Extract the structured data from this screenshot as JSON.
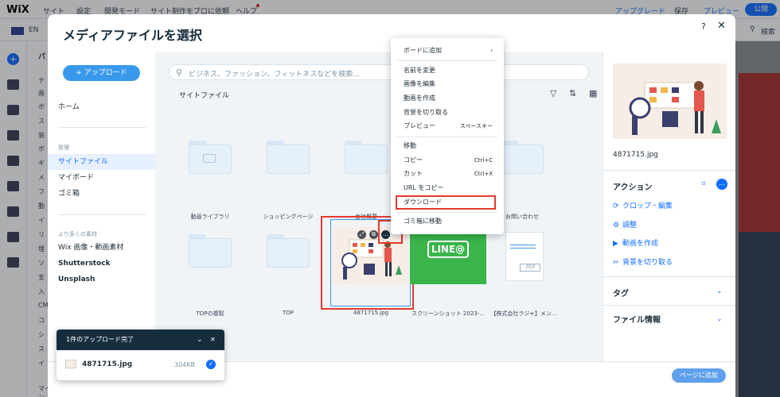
{
  "editor": {
    "logo": "WiX",
    "menu": [
      "サイト",
      "設定",
      "開発モード",
      "サイト制作をプロに依頼",
      "ヘルプ"
    ],
    "right_menu": [
      "アップグレード",
      "保存",
      "プレビュー"
    ],
    "publish": "公開",
    "language": "EN",
    "search": "検索",
    "panel_labels": [
      "パ",
      "テ",
      "画",
      "ボ",
      "ス",
      "装",
      "ボ",
      "ギ",
      "メ",
      "フ",
      "動",
      "イ",
      "リ",
      "埋",
      "ソ",
      "支",
      "入",
      "CM",
      "コ",
      "シ",
      "ス",
      "イ",
      "マイデザイン"
    ]
  },
  "modal": {
    "title": "メディアファイルを選択",
    "help": "?",
    "close": "✕",
    "upload_button": "+ アップロード",
    "sidebar": {
      "home": "ホーム",
      "manage_header": "管理",
      "manage_items": [
        "サイトファイル",
        "マイボード",
        "ゴミ箱"
      ],
      "more_header": "より多くの素材",
      "more_items": [
        "Wix 画像・動画素材",
        "Shutterstock",
        "Unsplash"
      ]
    },
    "search_placeholder": "ビジネス、ファッション、フィットネスなどを検索...",
    "breadcrumb": "サイトファイル",
    "files": [
      {
        "name": "動画ライブラリ",
        "type": "folder"
      },
      {
        "name": "ショッピングページ",
        "type": "folder"
      },
      {
        "name": "会社概要",
        "type": "folder"
      },
      {
        "name": "お問い合わせ",
        "type": "folder"
      },
      {
        "name": "TOPの複製",
        "type": "folder"
      },
      {
        "name": "TOP",
        "type": "folder"
      },
      {
        "name": "4871715.jpg",
        "type": "image"
      },
      {
        "name": "スクリーンショット 2023-...",
        "type": "image"
      },
      {
        "name": "【株式会社ラジャ】メン...",
        "type": "pdf"
      }
    ],
    "line_logo": "LINE@",
    "pdf_label": ".PDF",
    "details": {
      "file_name": "4871715.jpg",
      "actions_header": "アクション",
      "actions": [
        "クロップ・編集",
        "調整",
        "動画を作成",
        "背景を切り取る"
      ],
      "tags_header": "タグ",
      "info_header": "ファイル情報"
    },
    "add_button": "ページに追加"
  },
  "context_menu": {
    "items": [
      {
        "label": "ボードに追加",
        "shortcut": "›"
      },
      {
        "label": "名前を変更",
        "shortcut": ""
      },
      {
        "label": "画像を編集",
        "shortcut": ""
      },
      {
        "label": "動画を作成",
        "shortcut": ""
      },
      {
        "label": "背景を切り取る",
        "shortcut": ""
      },
      {
        "label": "プレビュー",
        "shortcut": "スペースキー"
      },
      {
        "label": "移動",
        "shortcut": ""
      },
      {
        "label": "コピー",
        "shortcut": "Ctrl+C"
      },
      {
        "label": "カット",
        "shortcut": "Ctrl+X"
      },
      {
        "label": "URL をコピー",
        "shortcut": ""
      },
      {
        "label": "ダウンロード",
        "shortcut": ""
      },
      {
        "label": "ゴミ箱に移動",
        "shortcut": ""
      }
    ]
  },
  "upload_toast": {
    "title": "1件のアップロード完了",
    "file_name": "4871715.jpg",
    "file_size": "304KB"
  },
  "colors": {
    "accent": "#116dff",
    "highlight": "#e23a2e",
    "toast_header": "#162d3d"
  }
}
